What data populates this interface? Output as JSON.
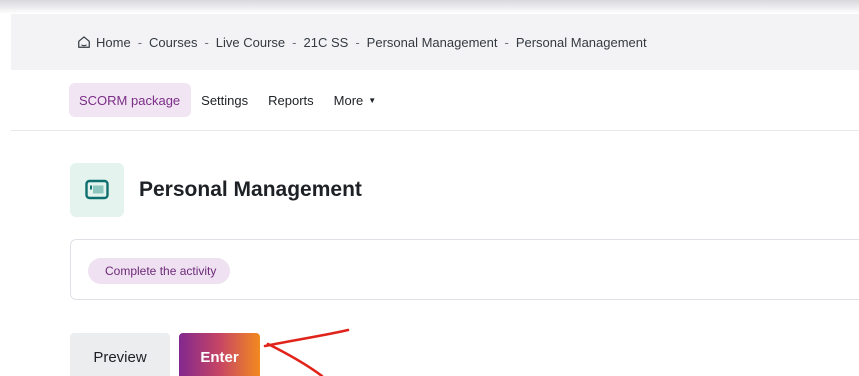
{
  "breadcrumb": {
    "home_icon": "home-icon",
    "items": [
      "Home",
      "Courses",
      "Live Course",
      "21C SS",
      "Personal Management",
      "Personal Management"
    ],
    "separator": "-"
  },
  "secondary_nav": {
    "items": [
      {
        "label": "SCORM package",
        "active": true
      },
      {
        "label": "Settings",
        "active": false
      },
      {
        "label": "Reports",
        "active": false
      },
      {
        "label": "More",
        "active": false,
        "dropdown": true
      }
    ],
    "caret_icon": "caret-down-icon"
  },
  "activity": {
    "icon": "scorm-package-icon",
    "title": "Personal Management"
  },
  "completion": {
    "badge_label": "Complete the activity"
  },
  "actions": {
    "preview_label": "Preview",
    "enter_label": "Enter"
  },
  "annotation": {
    "type": "hand-drawn arrow",
    "color": "#e0241b"
  },
  "colors": {
    "accent": "#82288f",
    "active_nav_bg": "#f1e4f3",
    "badge_bg": "#efe1f1",
    "icon_bg": "#e4f3ee",
    "icon_teal": "#0f6e6e",
    "enter_gradient_start": "#82288f",
    "enter_gradient_end": "#f28a1f"
  }
}
